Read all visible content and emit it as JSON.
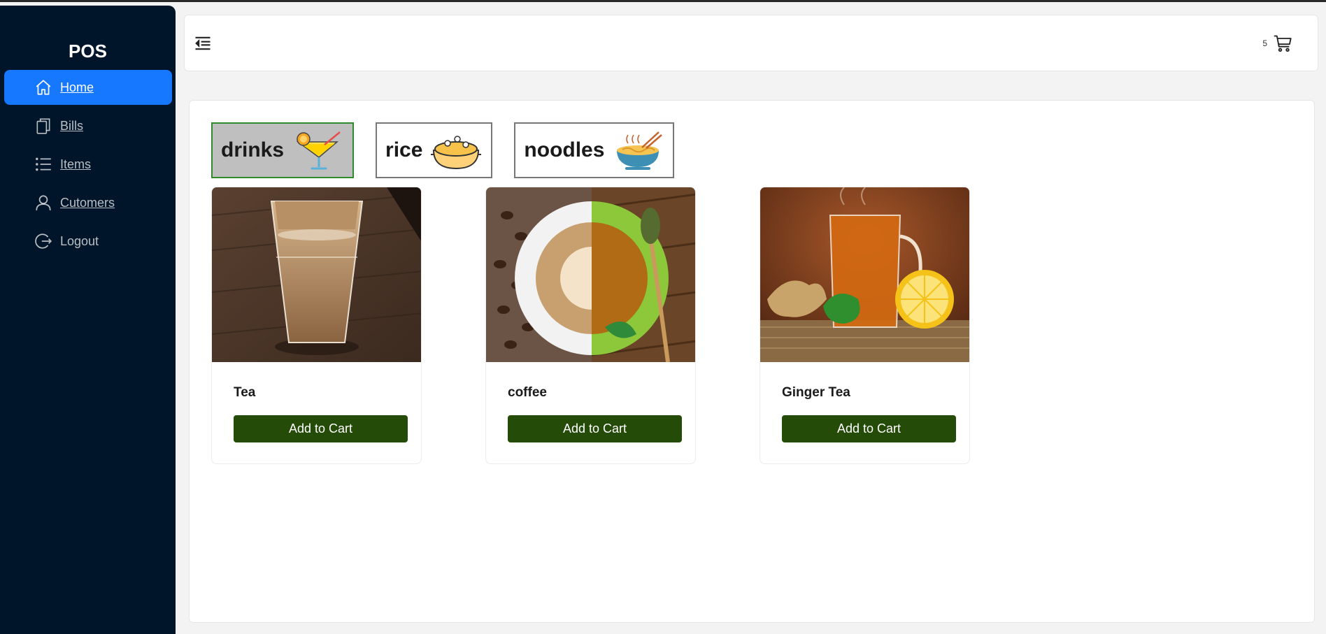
{
  "app": {
    "title": "POS"
  },
  "sidebar": {
    "items": [
      {
        "label": "Home",
        "icon": "home-icon",
        "active": true
      },
      {
        "label": "Bills",
        "icon": "copy-icon",
        "active": false
      },
      {
        "label": "Items",
        "icon": "list-icon",
        "active": false
      },
      {
        "label": "Cutomers",
        "icon": "user-icon",
        "active": false
      },
      {
        "label": "Logout",
        "icon": "logout-icon",
        "active": false
      }
    ]
  },
  "header": {
    "collapse_icon": "menu-fold-icon",
    "cart_count": "5",
    "cart_icon": "shopping-cart-icon"
  },
  "categories": [
    {
      "name": "drinks",
      "icon": "cocktail-icon",
      "active": true
    },
    {
      "name": "rice",
      "icon": "rice-pot-icon",
      "active": false
    },
    {
      "name": "noodles",
      "icon": "noodle-bowl-icon",
      "active": false
    }
  ],
  "items": [
    {
      "name": "Tea",
      "button": "Add to Cart",
      "image": "milk-tea-glass-photo"
    },
    {
      "name": "coffee",
      "button": "Add to Cart",
      "image": "coffee-and-green-tea-cup-photo"
    },
    {
      "name": "Ginger Tea",
      "button": "Add to Cart",
      "image": "ginger-lemon-tea-photo"
    }
  ],
  "colors": {
    "sidebar_bg": "#001529",
    "active_menu": "#1677ff",
    "button_bg": "#254b09",
    "active_category_bg": "#bfbfbf",
    "active_category_border": "#2e8b2e"
  }
}
